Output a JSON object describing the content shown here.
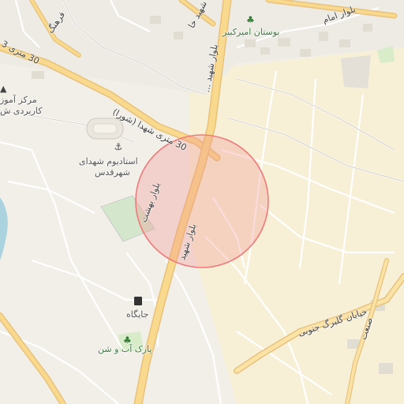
{
  "map": {
    "highlight_color": "#f28b8b",
    "labels": {
      "stadium_line1": "استادیوم شهدای",
      "stadium_line2": "شهرقدس",
      "amirkabir_park": "بوستان امیرکبیر",
      "training_center_line1": "مرکز آموز",
      "training_center_line2": "کاربردی ش",
      "fuel_station": "جایگاه",
      "water_park": "پارک آب و شن",
      "garden_street": "خیابان گلبرگ جنوبی",
      "industry_street": "صنعت"
    },
    "roads": {
      "road_30m_upper": "30 متری 3",
      "road_30m_shora": "30 متری شهدا (شورا)",
      "boulevard_main": "بلوار شهید",
      "boulevard_lower": "بلوار بهشت",
      "boulevard_upper": "بلوار شهید ...",
      "boulevard_imam": "بلوار امام",
      "street_top_left": "فرهنگ",
      "street_top_mid": "شهید خا"
    },
    "icons": {
      "stadium": "stadium-icon",
      "park": "tree-icon",
      "school": "education-icon",
      "fuel": "fuel-icon"
    }
  }
}
